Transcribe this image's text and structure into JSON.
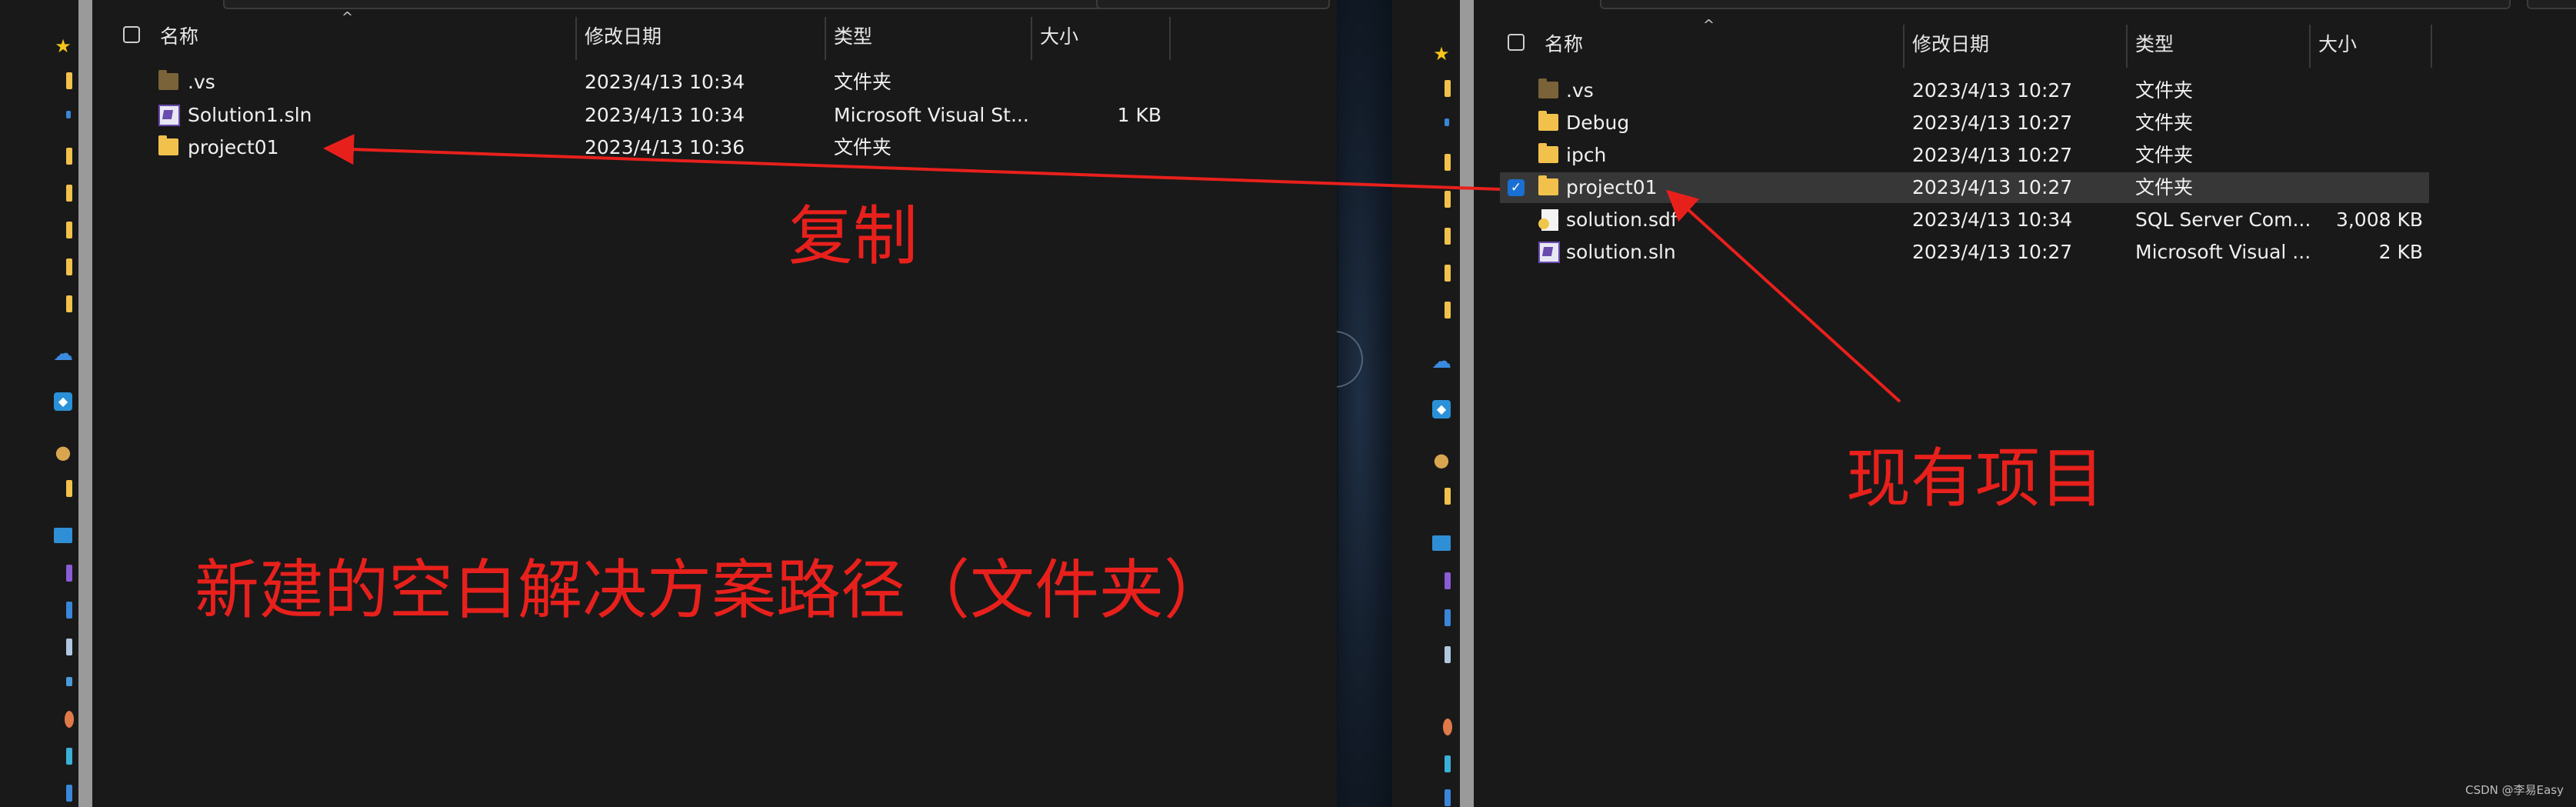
{
  "left_window": {
    "columns": {
      "name": "名称",
      "date": "修改日期",
      "type": "类型",
      "size": "大小"
    },
    "rows": [
      {
        "name": ".vs",
        "date": "2023/4/13 10:34",
        "type": "文件夹",
        "size": "",
        "icon": "folder-dark-icon"
      },
      {
        "name": "Solution1.sln",
        "date": "2023/4/13 10:34",
        "type": "Microsoft Visual St...",
        "size": "1 KB",
        "icon": "visual-studio-solution-icon"
      },
      {
        "name": "project01",
        "date": "2023/4/13 10:36",
        "type": "文件夹",
        "size": "",
        "icon": "folder-icon"
      }
    ]
  },
  "right_window": {
    "columns": {
      "name": "名称",
      "date": "修改日期",
      "type": "类型",
      "size": "大小"
    },
    "rows": [
      {
        "name": ".vs",
        "date": "2023/4/13 10:27",
        "type": "文件夹",
        "size": "",
        "icon": "folder-dark-icon"
      },
      {
        "name": "Debug",
        "date": "2023/4/13 10:27",
        "type": "文件夹",
        "size": "",
        "icon": "folder-icon"
      },
      {
        "name": "ipch",
        "date": "2023/4/13 10:27",
        "type": "文件夹",
        "size": "",
        "icon": "folder-icon"
      },
      {
        "name": "project01",
        "date": "2023/4/13 10:27",
        "type": "文件夹",
        "size": "",
        "icon": "folder-icon",
        "selected": true
      },
      {
        "name": "solution.sdf",
        "date": "2023/4/13 10:34",
        "type": "SQL Server Com...",
        "size": "3,008 KB",
        "icon": "sql-database-file-icon"
      },
      {
        "name": "solution.sln",
        "date": "2023/4/13 10:27",
        "type": "Microsoft Visual ...",
        "size": "2 KB",
        "icon": "visual-studio-solution-icon"
      }
    ]
  },
  "annotations": {
    "copy": "复制",
    "new_solution_path": "新建的空白解决方案路径（文件夹）",
    "existing_project": "现有项目"
  },
  "watermark": "CSDN @李易Easy",
  "colors": {
    "annotation": "#e8201c",
    "window_bg": "#191919",
    "selection": "#373737",
    "folder": "#f2c14b",
    "folder_dark": "#7a6338",
    "checkbox_accent": "#1a6fd2"
  }
}
